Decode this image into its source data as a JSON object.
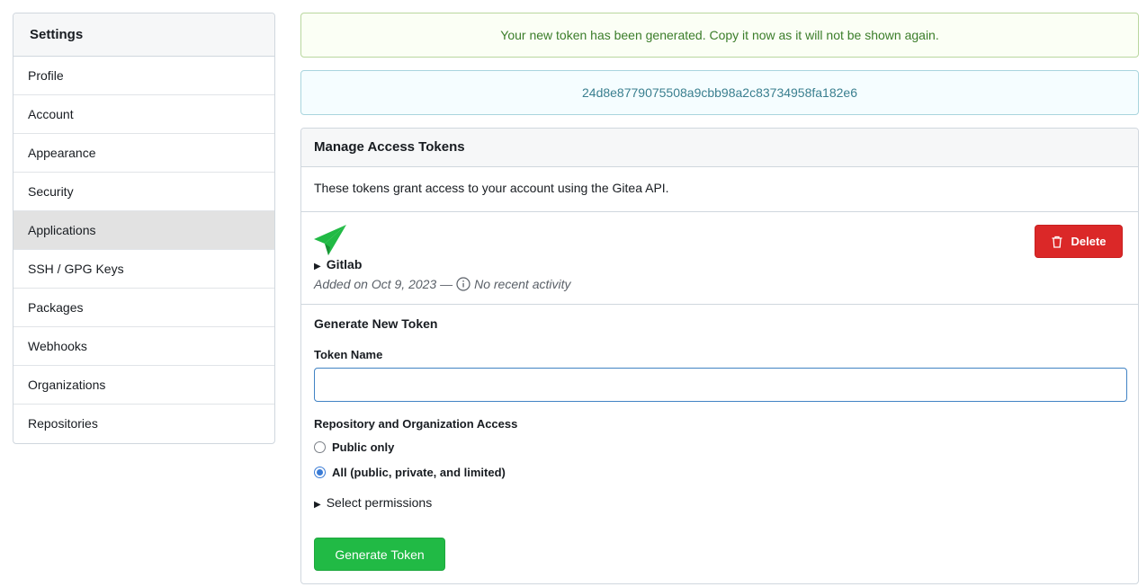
{
  "sidebar": {
    "title": "Settings",
    "items": [
      {
        "label": "Profile"
      },
      {
        "label": "Account"
      },
      {
        "label": "Appearance"
      },
      {
        "label": "Security"
      },
      {
        "label": "Applications",
        "active": true
      },
      {
        "label": "SSH / GPG Keys"
      },
      {
        "label": "Packages"
      },
      {
        "label": "Webhooks"
      },
      {
        "label": "Organizations"
      },
      {
        "label": "Repositories"
      }
    ]
  },
  "messages": {
    "success": "Your new token has been generated. Copy it now as it will not be shown again.",
    "token_value": "24d8e8779075508a9cbb98a2c83734958fa182e6"
  },
  "tokens_panel": {
    "title": "Manage Access Tokens",
    "description": "These tokens grant access to your account using the Gitea API.",
    "token": {
      "name": "Gitlab",
      "added": "Added on Oct 9, 2023 —",
      "activity": "No recent activity",
      "delete_label": "Delete",
      "icon": "paper-plane-icon"
    }
  },
  "generate": {
    "title": "Generate New Token",
    "token_name_label": "Token Name",
    "token_name_value": "",
    "token_name_placeholder": "",
    "access_label": "Repository and Organization Access",
    "options": [
      {
        "label": "Public only",
        "checked": false
      },
      {
        "label": "All (public, private, and limited)",
        "checked": true
      }
    ],
    "permissions_label": "Select permissions",
    "button_label": "Generate Token"
  },
  "colors": {
    "success_text": "#3b7d2a",
    "token_text": "#3a7f8f",
    "delete": "#db2828",
    "generate": "#21ba45",
    "plane_icon": "#21ba45"
  }
}
